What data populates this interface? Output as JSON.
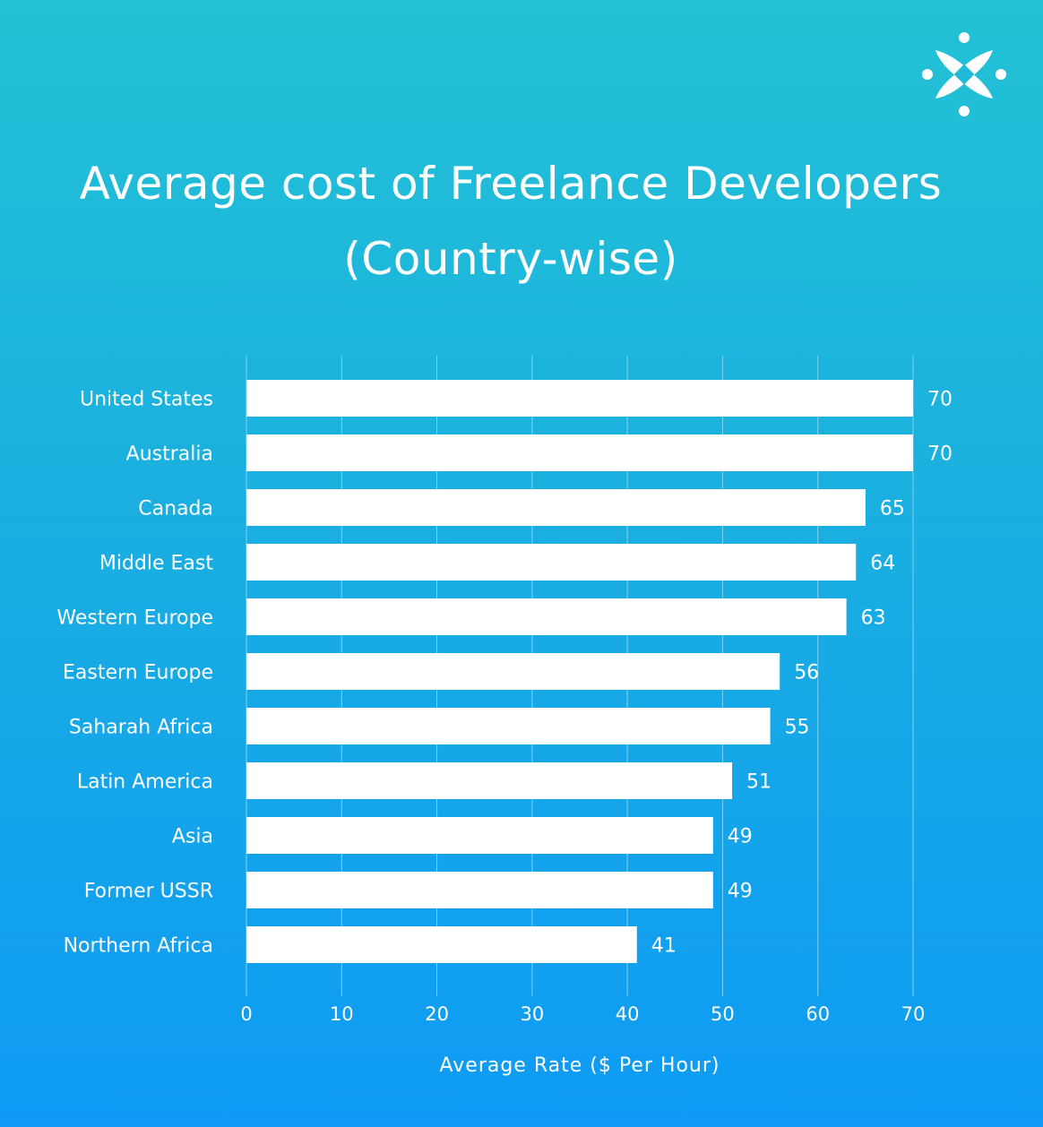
{
  "logo": {
    "icon": "four-petal-star-logo-icon"
  },
  "colors": {
    "bg_top": "#23C2D5",
    "bg_bottom": "#0E9AF5",
    "bar": "#FFFFFF",
    "text": "#FFFFFF",
    "grid": "#7FD3F2"
  },
  "chart_data": {
    "type": "bar",
    "orientation": "horizontal",
    "title": "Average cost of Freelance Developers (Country-wise)",
    "title_lines": [
      "Average cost of Freelance Developers",
      "(Country-wise)"
    ],
    "categories": [
      "United States",
      "Australia",
      "Canada",
      "Middle East",
      "Western Europe",
      "Eastern Europe",
      "Saharah Africa",
      "Latin America",
      "Asia",
      "Former USSR",
      "Northern Africa"
    ],
    "values": [
      70,
      70,
      65,
      64,
      63,
      56,
      55,
      51,
      49,
      49,
      41
    ],
    "data_labels": [
      "70",
      "70",
      "65",
      "64",
      "63",
      "56",
      "55",
      "51",
      "49",
      "49",
      "41"
    ],
    "xlabel": "Average Rate ($ Per Hour)",
    "ylabel": "",
    "xlim": [
      0,
      70
    ],
    "xticks": [
      0,
      10,
      20,
      30,
      40,
      50,
      60,
      70
    ],
    "grid": true,
    "legend": "none"
  }
}
